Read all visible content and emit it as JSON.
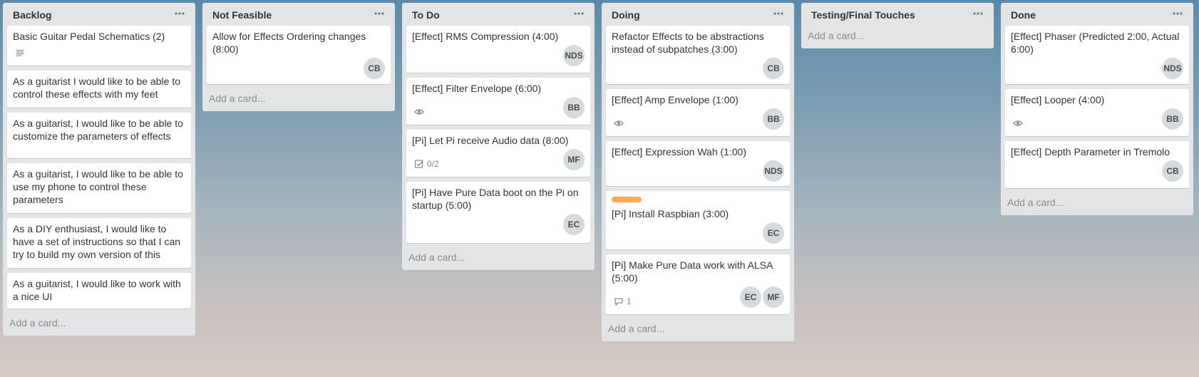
{
  "colors": {
    "list_background": "#e2e4e6",
    "card_background": "#ffffff",
    "avatar_background": "#d6dadc",
    "label_orange": "#ffab4a",
    "muted_text": "#8c8c8c"
  },
  "lists": [
    {
      "title": "Backlog",
      "add_card": "Add a card...",
      "cards": [
        {
          "title": "Basic Guitar Pedal Schematics (2)",
          "badges": [
            {
              "icon": "description-icon",
              "text": ""
            }
          ],
          "members": []
        },
        {
          "title": "As a guitarist I would like to be able to control these effects with my feet",
          "badges": [],
          "members": []
        },
        {
          "title": "As a guitarist, I would like to be able to customize the parameters of effects",
          "badges": [],
          "members": []
        },
        {
          "title": "As a guitarist, I would like to be able to use my phone to control these parameters",
          "badges": [],
          "members": []
        },
        {
          "title": "As a DIY enthusiast, I would like to have a set of instructions so that I can try to build my own version of this",
          "badges": [],
          "members": []
        },
        {
          "title": "As a guitarist, I would like to work with a nice UI",
          "badges": [],
          "members": []
        }
      ]
    },
    {
      "title": "Not Feasible",
      "add_card": "Add a card...",
      "cards": [
        {
          "title": "Allow for Effects Ordering changes (8:00)",
          "badges": [],
          "members": [
            "CB"
          ]
        }
      ]
    },
    {
      "title": "To Do",
      "add_card": "Add a card...",
      "cards": [
        {
          "title": "[Effect] RMS Compression (4:00)",
          "badges": [],
          "members": [
            "NDS"
          ]
        },
        {
          "title": "[Effect] Filter Envelope (6:00)",
          "badges": [
            {
              "icon": "eye-icon",
              "text": ""
            }
          ],
          "members": [
            "BB"
          ]
        },
        {
          "title": "[Pi] Let Pi receive Audio data (8:00)",
          "badges": [
            {
              "icon": "checklist-icon",
              "text": "0/2"
            }
          ],
          "members": [
            "MF"
          ]
        },
        {
          "title": "[Pi] Have Pure Data boot on the Pi on startup (5:00)",
          "badges": [],
          "members": [
            "EC"
          ]
        }
      ]
    },
    {
      "title": "Doing",
      "add_card": "Add a card...",
      "cards": [
        {
          "title": "Refactor Effects to be abstractions instead of subpatches (3:00)",
          "badges": [],
          "members": [
            "CB"
          ]
        },
        {
          "title": "[Effect] Amp Envelope (1:00)",
          "badges": [
            {
              "icon": "eye-icon",
              "text": ""
            }
          ],
          "members": [
            "BB"
          ]
        },
        {
          "title": "[Effect] Expression Wah (1:00)",
          "badges": [],
          "members": [
            "NDS"
          ]
        },
        {
          "title": "[Pi] Install Raspbian (3:00)",
          "label": "#ffab4a",
          "badges": [],
          "members": [
            "EC"
          ]
        },
        {
          "title": "[Pi] Make Pure Data work with ALSA (5:00)",
          "badges": [
            {
              "icon": "comment-icon",
              "text": "1"
            }
          ],
          "members": [
            "EC",
            "MF"
          ]
        }
      ]
    },
    {
      "title": "Testing/Final Touches",
      "add_card": "Add a card...",
      "cards": []
    },
    {
      "title": "Done",
      "add_card": "Add a card...",
      "cards": [
        {
          "title": "[Effect] Phaser (Predicted 2:00, Actual 6:00)",
          "badges": [],
          "members": [
            "NDS"
          ]
        },
        {
          "title": "[Effect] Looper (4:00)",
          "badges": [
            {
              "icon": "eye-icon",
              "text": ""
            }
          ],
          "members": [
            "BB"
          ]
        },
        {
          "title": "[Effect] Depth Parameter in Tremolo",
          "badges": [],
          "members": [
            "CB"
          ]
        }
      ]
    }
  ]
}
